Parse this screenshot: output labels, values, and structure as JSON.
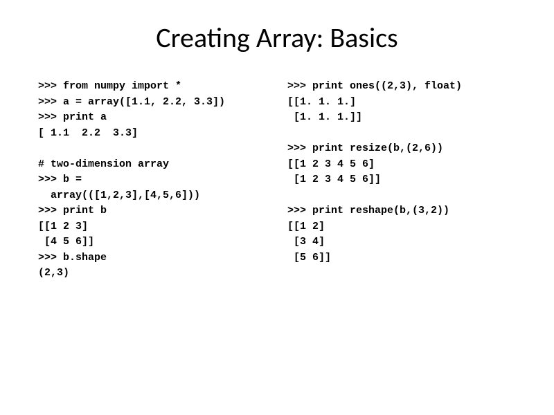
{
  "title": "Creating Array: Basics",
  "left": {
    "l1": ">>> from numpy import *",
    "l2": ">>> a = array([1.1, 2.2, 3.3])",
    "l3": ">>> print a",
    "l4": "[ 1.1  2.2  3.3]",
    "l5": "",
    "l6": "# two-dimension array",
    "l7": ">>> b =",
    "l8": "  array(([1,2,3],[4,5,6]))",
    "l9": ">>> print b",
    "l10": "[[1 2 3]",
    "l11": " [4 5 6]]",
    "l12": ">>> b.shape",
    "l13": "(2,3)"
  },
  "right": {
    "r1": ">>> print ones((2,3), float)",
    "r2": "[[1. 1. 1.]",
    "r3": " [1. 1. 1.]]",
    "r4": "",
    "r5": ">>> print resize(b,(2,6))",
    "r6": "[[1 2 3 4 5 6]",
    "r7": " [1 2 3 4 5 6]]",
    "r8": "",
    "r9": ">>> print reshape(b,(3,2))",
    "r10": "[[1 2]",
    "r11": " [3 4]",
    "r12": " [5 6]]"
  }
}
